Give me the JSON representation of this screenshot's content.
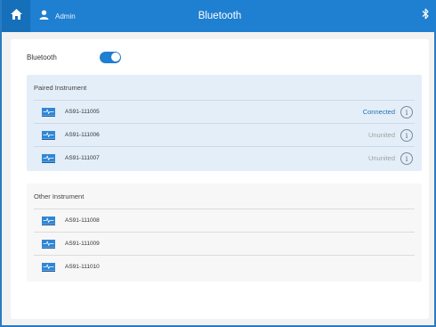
{
  "header": {
    "title": "Bluetooth",
    "user_label": "Admin",
    "home_icon": "home-icon",
    "user_icon": "user-icon",
    "bluetooth_icon": "bluetooth-icon",
    "accent_color": "#1f7fd0"
  },
  "bluetooth": {
    "label": "Bluetooth",
    "enabled": true
  },
  "paired": {
    "title": "Paired Instrument",
    "items": [
      {
        "name": "AS91-111005",
        "status": "Connected"
      },
      {
        "name": "AS91-111006",
        "status": "Ununited"
      },
      {
        "name": "AS91-111007",
        "status": "Ununited"
      }
    ]
  },
  "other": {
    "title": "Other Instrument",
    "items": [
      {
        "name": "AS91-111008"
      },
      {
        "name": "AS91-111009"
      },
      {
        "name": "AS91-111010"
      }
    ]
  }
}
